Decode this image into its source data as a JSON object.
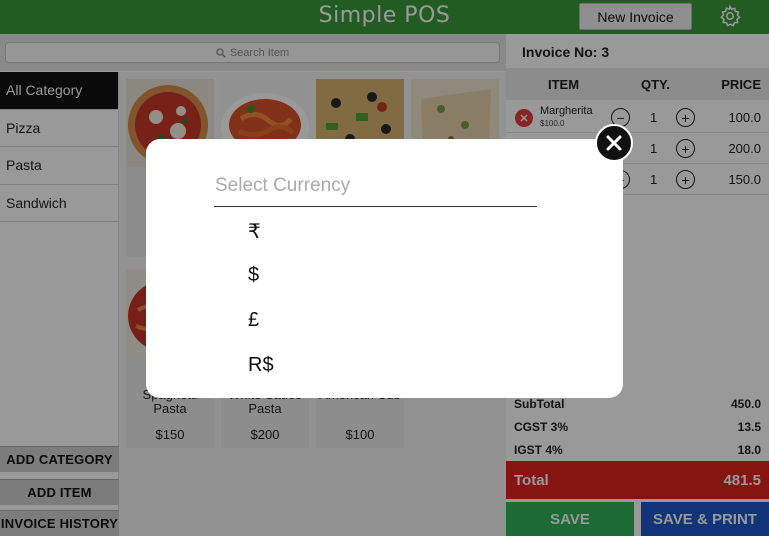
{
  "header": {
    "title": "Simple POS",
    "new_invoice_label": "New Invoice"
  },
  "search": {
    "placeholder": "Search Item"
  },
  "categories": [
    "All Category",
    "Pizza",
    "Pasta",
    "Sandwich"
  ],
  "sidebar_buttons": {
    "add_category": "ADD CATEGORY",
    "add_item": "ADD ITEM",
    "invoice_history": "INVOICE HISTORY"
  },
  "products_row2": [
    {
      "name": "Spaghetti Pasta",
      "price": "$150"
    },
    {
      "name": "White Sauce Pasta",
      "price": "$200"
    },
    {
      "name": "American Sub",
      "price": "$100"
    }
  ],
  "invoice": {
    "label": "Invoice No: 3",
    "headers": {
      "item": "ITEM",
      "qty": "QTY.",
      "price": "PRICE"
    },
    "rows": [
      {
        "name": "Margherita",
        "unit_price": "$100.0",
        "qty": "1",
        "price": "100.0"
      },
      {
        "qty": "1",
        "price": "200.0"
      },
      {
        "qty": "1",
        "price": "150.0"
      }
    ],
    "subtotal_label": "SubTotal",
    "subtotal": "450.0",
    "cgst_label": "CGST 3%",
    "cgst": "13.5",
    "igst_label": "IGST  4%",
    "igst": "18.0",
    "total_label": "Total",
    "total": "481.5",
    "save_label": "SAVE",
    "save_print_label": "SAVE & PRINT"
  },
  "currency_modal": {
    "placeholder": "Select Currency",
    "options": [
      "₹",
      "$",
      "£",
      "R$"
    ]
  },
  "colors": {
    "header_green": "#3a9a3a",
    "total_red": "#e0241f",
    "save_green": "#2fb157",
    "save_print_blue": "#1f55c9"
  }
}
